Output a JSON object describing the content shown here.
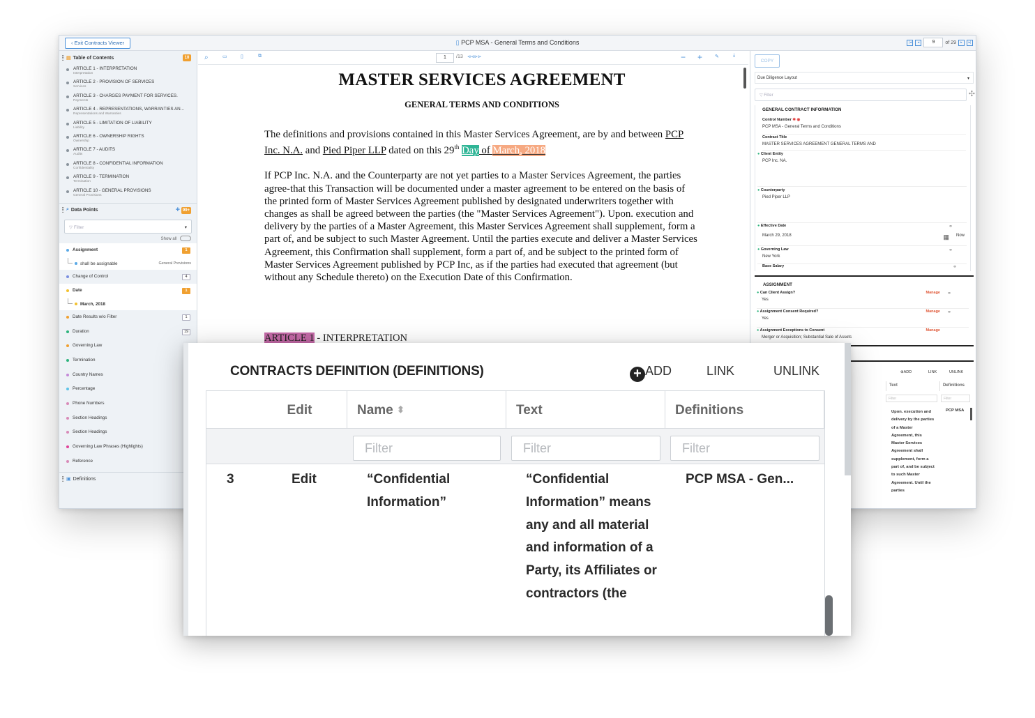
{
  "viewer": {
    "exit_label": "Exit Contracts Viewer",
    "title": "PCP MSA - General Terms and Conditions",
    "page_input": "9",
    "page_of": "of 29"
  },
  "toc": {
    "title": "Table of Contents",
    "badge": "10",
    "items": [
      {
        "title": "ARTICLE 1 - INTERPRETATION",
        "sub": "Interpretation"
      },
      {
        "title": "ARTICLE 2 - PROVISION OF SERVICES",
        "sub": "Services"
      },
      {
        "title": "ARTICLE 3 - CHARGES PAYMENT FOR SERVICES.",
        "sub": "Payments"
      },
      {
        "title": "ARTICLE 4 - REPRESENTATIONS, WARRANTIES AN...",
        "sub": "Representations and Warranties"
      },
      {
        "title": "ARTICLE 5 - LIMITATION OF LIABILITY",
        "sub": "Liability"
      },
      {
        "title": "ARTICLE 6 - OWNERSHIP RIGHTS",
        "sub": "Ownership"
      },
      {
        "title": "ARTICLE 7 - AUDITS",
        "sub": "Audits"
      },
      {
        "title": "ARTICLE 8 - CONFIDENTIAL INFORMATION",
        "sub": "Confidentiality"
      },
      {
        "title": "ARTICLE 9 - TERMINATION",
        "sub": "Termination"
      },
      {
        "title": "ARTICLE 10 - GENERAL PROVISIONS",
        "sub": "General Provisions"
      }
    ]
  },
  "datapoints": {
    "title": "Data Points",
    "badge": "99+",
    "filter_placeholder": "Filter",
    "show_all": "Show all",
    "items": [
      {
        "label": "Assignment",
        "count": "1",
        "color": "#5aa9e6",
        "orange": true,
        "selected": true
      },
      {
        "label": "shall be assignable",
        "right": "General Provisions",
        "color": "#5aa9e6",
        "sub": true
      },
      {
        "label": "Change of Control",
        "count": "4",
        "color": "#7b8fe0"
      },
      {
        "label": "Date",
        "count": "1",
        "color": "#f2c12e",
        "orange": true,
        "selected": true
      },
      {
        "label": "March, 2018",
        "color": "#f2c12e",
        "sub": true,
        "bold": true
      },
      {
        "label": "Date Results w/o Filter",
        "count": "1",
        "color": "#f0a030"
      },
      {
        "label": "Duration",
        "count": "19",
        "color": "#2db47d"
      },
      {
        "label": "Governing Law",
        "count": "",
        "color": "#f0a030"
      },
      {
        "label": "Termination",
        "count": "",
        "color": "#2db47d"
      },
      {
        "label": "Country Names",
        "count": "",
        "color": "#c48ad8"
      },
      {
        "label": "Percentage",
        "count": "",
        "color": "#5ec3e8"
      },
      {
        "label": "Phone Numbers",
        "count": "",
        "color": "#d88ab8"
      },
      {
        "label": "Section Headings",
        "count": "",
        "color": "#d88ab8"
      },
      {
        "label": "Section Headings",
        "count": "",
        "color": "#d88ab8"
      },
      {
        "label": "Governing Law Phrases (Highlights)",
        "count": "",
        "color": "#e0449a"
      },
      {
        "label": "Reference",
        "count": "",
        "color": "#d88ab8"
      }
    ]
  },
  "definitions_section": {
    "title": "Definitions"
  },
  "doc_toolbar": {
    "page": "1",
    "of": "/13"
  },
  "document": {
    "title": "MASTER SERVICES AGREEMENT",
    "subtitle": "GENERAL TERMS AND CONDITIONS",
    "p1_a": "The definitions and provisions contained in this Master Services Agreement, are by and between",
    "p1_party1": "PCP Inc. N.A.",
    "p1_and": " and ",
    "p1_party2": "Pied Piper LLP",
    "p1_dated": " dated on this 29",
    "p1_th": "th",
    "p1_day": "Day",
    "p1_of": " of ",
    "p1_date": "March, 2018",
    "p2": "If PCP Inc. N.A. and the Counterparty are not yet parties to a Master Services Agreement, the parties agree-that this Transaction will be documented under a master agreement to be entered on the basis of the printed form of Master Services Agreement published by designated underwriters together with changes as shall be agreed between the parties (the \"Master Services Agreement\"). Upon. execution and delivery by the parties of a Master Agreement, this Master Services Agreement shall supplement, form a part of, and be subject to such Master Agreement. Until the parties execute and deliver a Master Services Agreement, this Confirmation shall supplement, form a part of, and be subject to the printed form of Master Services Agreement published by PCP Inc, as if the parties had executed that agreement (but without any Schedule thereto) on the Execution Date of this Confirmation.",
    "article_tag": "ARTICLE 1",
    "article_rest": " - INTERPRETATION"
  },
  "right_panel": {
    "copy": "COPY",
    "layout": "Due Diligence Layout",
    "filter": "Filter",
    "general_title": "GENERAL CONTRACT INFORMATION",
    "fields": {
      "control_label": "Control Number",
      "control_value": "PCP MSA - General Terms and Conditions",
      "title_label": "Contract Title",
      "title_value": "MASTER SERVICES AGREEMENT GENERAL TERMS AND",
      "client_label": "Client Entity",
      "client_value": "PCP Inc. NA.",
      "counter_label": "Counterparty",
      "counter_value": "Pied Piper LLP",
      "eff_label": "Effective Date",
      "eff_value": "March 29, 2018",
      "now": "Now",
      "gov_label": "Governing Law",
      "gov_value": "New York",
      "salary_label": "Base Salary"
    },
    "assignment_title": "ASSIGNMENT",
    "assign": [
      {
        "label": "Can Client Assign?",
        "value": "Yes",
        "manage": "Manage"
      },
      {
        "label": "Assignment Consent Required?",
        "value": "Yes",
        "manage": "Manage"
      },
      {
        "label": "Assignment Exceptions to Consent",
        "value": "Merger or Acquisition; Substantial Sale of Assets",
        "manage": "Manage"
      }
    ],
    "mini_table": {
      "add": "ADD",
      "link": "LINK",
      "unlink": "UNLINK",
      "col_text": "Text",
      "col_defs": "Definitions",
      "filter": "Filter",
      "text_value": "Upon. execution and delivery by the parties of a Master Agreement, this Master Services Agreement shall supplement, form a part of, and be subject to such Master Agreement. Until the parties",
      "defs_value": "PCP MSA"
    }
  },
  "big_panel": {
    "title": "CONTRACTS DEFINITION (DEFINITIONS)",
    "add": "ADD",
    "link": "LINK",
    "unlink": "UNLINK",
    "columns": [
      "Edit",
      "Name",
      "Text",
      "Definitions"
    ],
    "filter_placeholder": "Filter",
    "row": {
      "index": "3",
      "edit": "Edit",
      "name": "“Confidential Information”",
      "text": "“Confidential Information” means any and all material and information of a Party, its Affiliates or contractors (the",
      "definitions": "PCP MSA - Gen..."
    }
  }
}
